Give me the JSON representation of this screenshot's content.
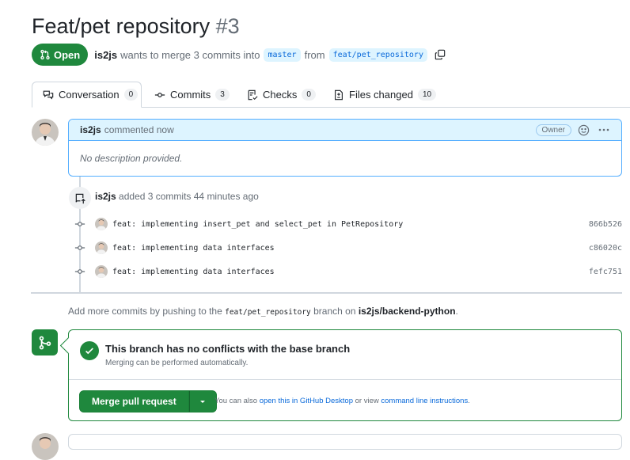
{
  "pr": {
    "title": "Feat/pet repository",
    "number": "#3",
    "state": "Open",
    "author": "is2js",
    "merge_text_1": "wants to merge 3 commits into",
    "base_branch": "master",
    "merge_text_2": "from",
    "head_branch": "feat/pet_repository"
  },
  "tabs": [
    {
      "label": "Conversation",
      "count": "0",
      "icon": "comment-discussion-icon"
    },
    {
      "label": "Commits",
      "count": "3",
      "icon": "git-commit-icon"
    },
    {
      "label": "Checks",
      "count": "0",
      "icon": "checklist-icon"
    },
    {
      "label": "Files changed",
      "count": "10",
      "icon": "file-diff-icon"
    }
  ],
  "comment": {
    "author": "is2js",
    "action": "commented now",
    "badge": "Owner",
    "body": "No description provided."
  },
  "timeline": {
    "author": "is2js",
    "text": "added 3 commits 44 minutes ago",
    "commits": [
      {
        "message": "feat: implementing insert_pet and select_pet in PetRepository",
        "sha": "866b526"
      },
      {
        "message": "feat: implementing data interfaces",
        "sha": "c86020c"
      },
      {
        "message": "feat: implementing data interfaces",
        "sha": "fefc751"
      }
    ]
  },
  "info": {
    "prefix": "Add more commits by pushing to the",
    "branch": "feat/pet_repository",
    "middle": "branch on",
    "repo": "is2js/backend-python",
    "suffix": "."
  },
  "merge": {
    "title": "This branch has no conflicts with the base branch",
    "subtitle": "Merging can be performed automatically.",
    "button": "Merge pull request",
    "alt_prefix": "You can also",
    "alt_link1": "open this in GitHub Desktop",
    "alt_middle": "or view",
    "alt_link2": "command line instructions",
    "alt_suffix": "."
  },
  "colors": {
    "green": "#1f883d",
    "blue": "#0969da",
    "comment_header": "#ddf4ff"
  }
}
